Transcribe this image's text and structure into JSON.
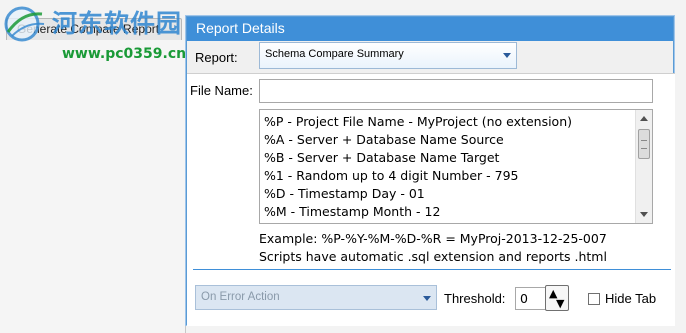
{
  "watermark": {
    "title": "河东软件园",
    "url": "www.pc0359.cn"
  },
  "left_tab": {
    "label": "Generate Compare Report"
  },
  "dialog": {
    "title": "Report Details",
    "report_label": "Report:",
    "report_value": "Schema Compare Summary",
    "file_name_label": "File Name:",
    "file_name_value": "",
    "tokens": [
      "%P - Project File Name - MyProject (no extension)",
      "%A - Server + Database Name Source",
      "%B - Server + Database Name Target",
      "%1 - Random up to 4 digit Number - 795",
      "%D - Timestamp Day - 01",
      "%M - Timestamp Month - 12"
    ],
    "example_text": "Example: %P-%Y-%M-%D-%R = MyProj-2013-12-25-007",
    "scripts_note": "Scripts have automatic .sql extension and reports .html",
    "error_action_value": "On Error Action",
    "threshold_label": "Threshold:",
    "threshold_value": "0",
    "hide_tab_label": "Hide Tab",
    "hide_tab_checked": false
  },
  "colors": {
    "accent": "#3f8fd8",
    "watermark_blue": "#2f86d0",
    "watermark_green": "#1a9a37"
  }
}
